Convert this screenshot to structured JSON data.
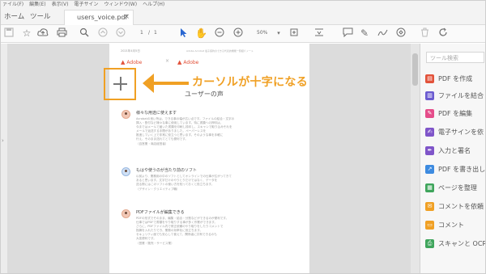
{
  "menu": [
    "ァイル(F)",
    "編集(E)",
    "表示(V)",
    "電子サイン",
    "ウィンドウ(W)",
    "ヘルプ(H)"
  ],
  "tabs": {
    "home": "ホーム",
    "tools": "ツール",
    "document": "users_voice.pdf",
    "close": "×"
  },
  "toolbar": {
    "page_current": "1",
    "page_separator": "/",
    "page_total": "1",
    "zoom": "50%"
  },
  "document": {
    "date": "2021年4月5日",
    "running_head": "Adobe Acrobat 電子契約のできる代表的機能一覧紹介ノート",
    "brand_left": "Adobe",
    "brand_sep": "×",
    "brand_right": "Adobe",
    "title": "ユーザーの声",
    "sections": [
      {
        "heading": "様々な用途に使えます",
        "lines": [
          "Acrobatの良い所は、できる事の幅が広い点です。ファイルの結合・文字の",
          "挿入・割付など様々な事に使用しています。特に書類への押印は、",
          "今まではメールで届いた書類を印刷し捺印し、スキャンで取り込みそれを",
          "メールで返送する手間がありました。ペーパーレスを",
          "推進していく上で非常に役立つと思います。そのような事を手軽に",
          "行え、そのまま送れてとても便利です。",
          "（自営業・商店経営者）"
        ]
      },
      {
        "heading": "もはや使うのが当たり前のソフト",
        "lines": [
          "以前より、業務用の中のソフトとしてオンラインでの仕事が広がってきて",
          "あると思います。文字だけのやりとりだけではなく、データを",
          "送る際にはこのソフトの使い方を知っておくと役立ちます。",
          "（デザイン・クリエイティブ職）"
        ]
      },
      {
        "heading": "PDFファイルが編集できる",
        "lines": [
          "PDFの形式でそのまま、編集・結合・分割などができるのが便利です。",
          "仕事ではPDFで書類をやり取りする事が多く作業ができます。",
          "さらに、PDFファイル内で修正依頼のやり取りをしたりコメントで",
          "指摘を入れたりでき、業務の効率化に役立ちます。",
          "セキュリティ面でも安心して使えて、関係者に共有できるのも",
          "大変便利です。",
          "（営業・販売・サービス業）"
        ]
      }
    ]
  },
  "right_pane": {
    "search_placeholder": "ツール検索",
    "items": [
      {
        "label": "PDF を作成",
        "color": "#e2523a",
        "icon": "create-pdf-icon"
      },
      {
        "label": "ファイルを結合",
        "color": "#6b5bd0",
        "icon": "combine-files-icon"
      },
      {
        "label": "PDF を編集",
        "color": "#e54d8a",
        "icon": "edit-pdf-icon"
      },
      {
        "label": "電子サインを依",
        "color": "#7f55c9",
        "icon": "request-signature-icon"
      },
      {
        "label": "入力と署名",
        "color": "#7f55c9",
        "icon": "fill-sign-icon"
      },
      {
        "label": "PDF を書き出し",
        "color": "#3d8be0",
        "icon": "export-pdf-icon"
      },
      {
        "label": "ページを整理",
        "color": "#3fa55c",
        "icon": "organize-pages-icon"
      },
      {
        "label": "コメントを依頼",
        "color": "#f0a024",
        "icon": "request-comments-icon"
      },
      {
        "label": "コメント",
        "color": "#f0a024",
        "icon": "comment-icon"
      },
      {
        "label": "スキャンと OCR",
        "color": "#3fa55c",
        "icon": "scan-ocr-icon"
      }
    ]
  },
  "annotation": {
    "text": "カーソルが十字になる",
    "color": "#f0a024"
  }
}
